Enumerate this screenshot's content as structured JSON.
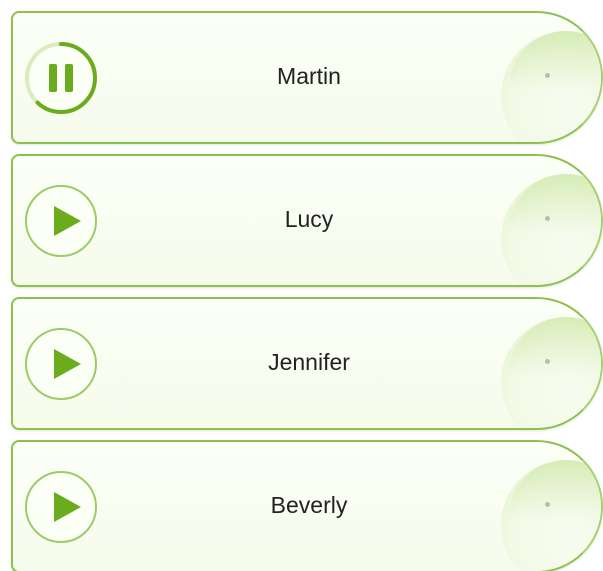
{
  "colors": {
    "accent": "#6aac1e",
    "border": "#8cc152",
    "card_bg": "#f6fbec"
  },
  "tracks": [
    {
      "name": "Martin",
      "state": "playing",
      "control_icon": "pause-icon",
      "progress": 0.62
    },
    {
      "name": "Lucy",
      "state": "paused",
      "control_icon": "play-icon"
    },
    {
      "name": "Jennifer",
      "state": "paused",
      "control_icon": "play-icon"
    },
    {
      "name": "Beverly",
      "state": "paused",
      "control_icon": "play-icon"
    }
  ]
}
